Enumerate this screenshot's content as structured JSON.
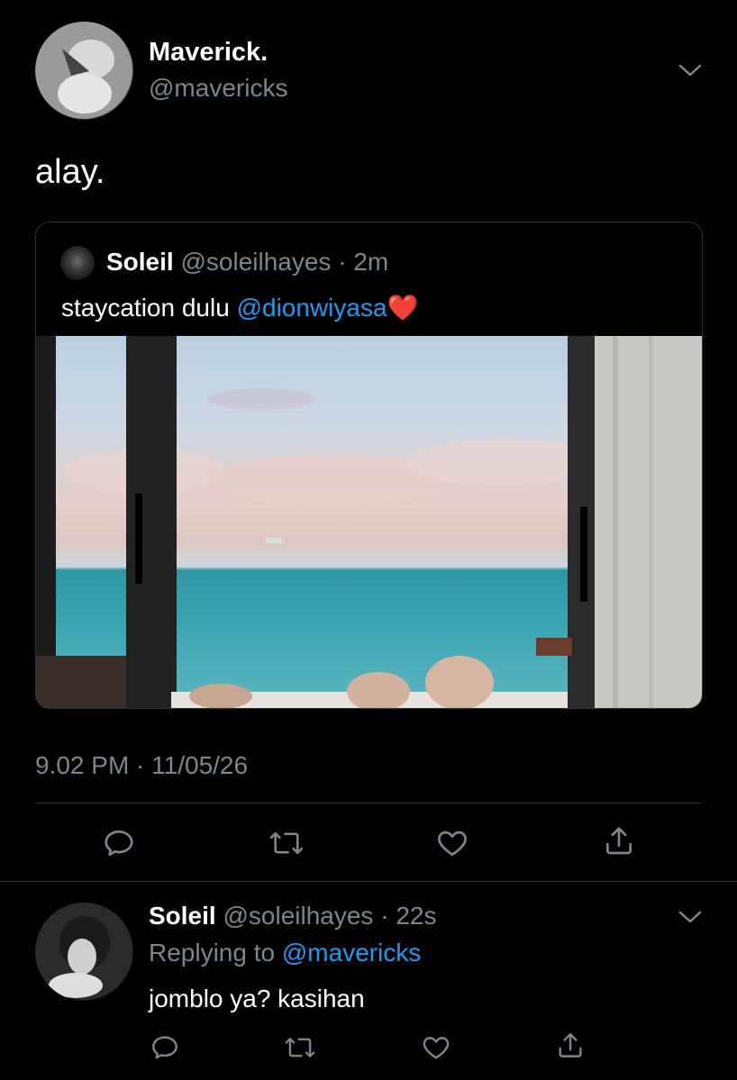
{
  "tweet": {
    "display_name": "Maverick.",
    "handle": "@mavericks",
    "text": "alay.",
    "timestamp": "9.02 PM · 11/05/26"
  },
  "quoted": {
    "display_name": "Soleil",
    "handle": "@soleilhayes",
    "time": "· 2m",
    "text": "staycation dulu ",
    "mention": "@dionwiyasa",
    "emoji": "❤️"
  },
  "reply": {
    "display_name": "Soleil",
    "handle": "@soleilhayes",
    "time": "· 22s",
    "replying_prefix": "Replying to ",
    "replying_to": "@mavericks",
    "text": "jomblo ya? kasihan"
  },
  "icons": [
    "chevron-down-icon",
    "reply-icon",
    "retweet-icon",
    "like-icon",
    "share-icon"
  ],
  "colors": {
    "background": "#000000",
    "link": "#1d9bf0",
    "muted": "#7d858d",
    "divider": "#2f3336"
  }
}
